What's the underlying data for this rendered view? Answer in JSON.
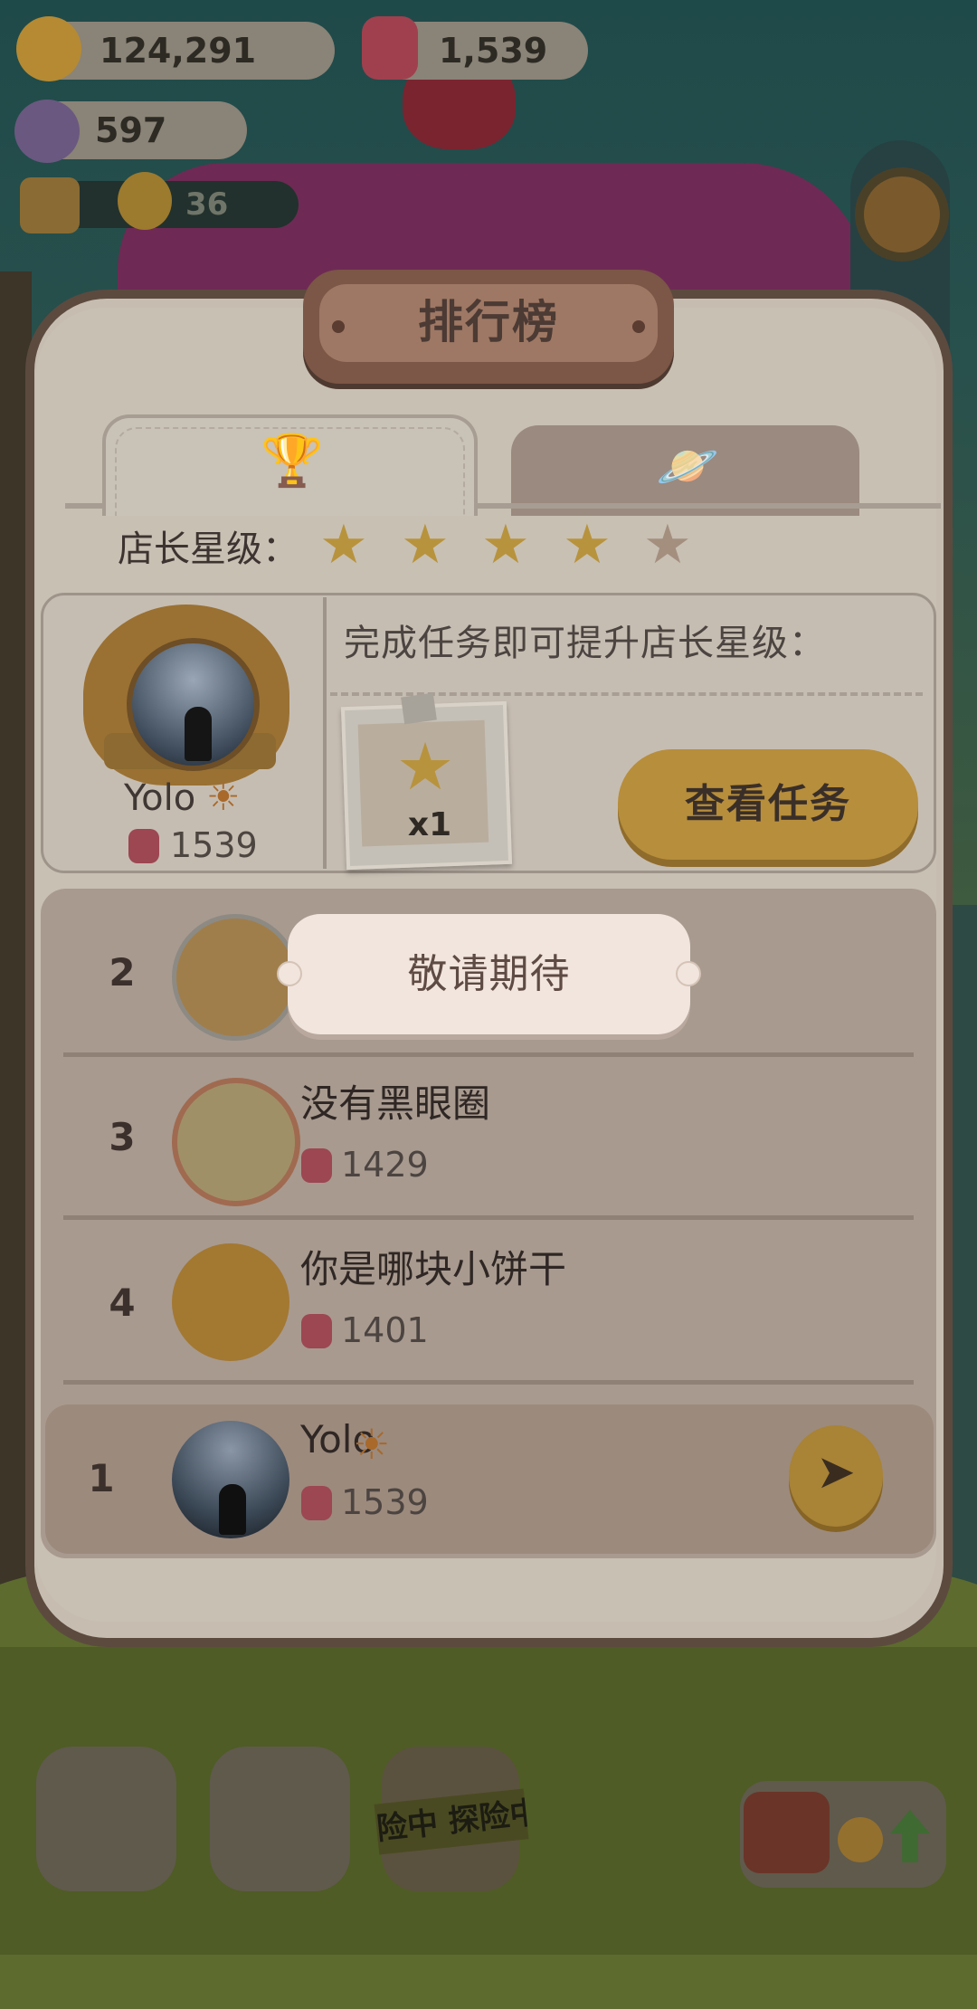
{
  "hud": {
    "coins": "124,291",
    "gems": "1,539",
    "tickets": "597",
    "visitors": "36"
  },
  "leaderboard": {
    "title": "排行榜",
    "tabs": [
      {
        "name": "trophy-tab",
        "icon": "trophy-icon",
        "active": true
      },
      {
        "name": "planet-tab",
        "icon": "planet-icon",
        "active": false
      }
    ],
    "star_label": "店长星级：",
    "stars_filled": 4,
    "stars_total": 5,
    "me": {
      "name": "Yolo",
      "score": "1539"
    },
    "task_hint": "完成任务即可提升店长星级：",
    "task_reward": "x1",
    "view_task_label": "查看任务",
    "coming_soon": "敬请期待",
    "rows": [
      {
        "rank": "2",
        "name": "",
        "score": ""
      },
      {
        "rank": "3",
        "name": "没有黑眼圈",
        "score": "1429"
      },
      {
        "rank": "4",
        "name": "你是哪块小饼干",
        "score": "1401"
      }
    ],
    "my_row": {
      "rank": "1",
      "name": "Yolo",
      "score": "1539"
    }
  },
  "bottom_nav": {
    "explore_tape": "险中 探险中"
  },
  "colors": {
    "panel_border": "#5c4a3f",
    "accent_gold": "#b78e3c",
    "score_icon": "#9c4752"
  }
}
